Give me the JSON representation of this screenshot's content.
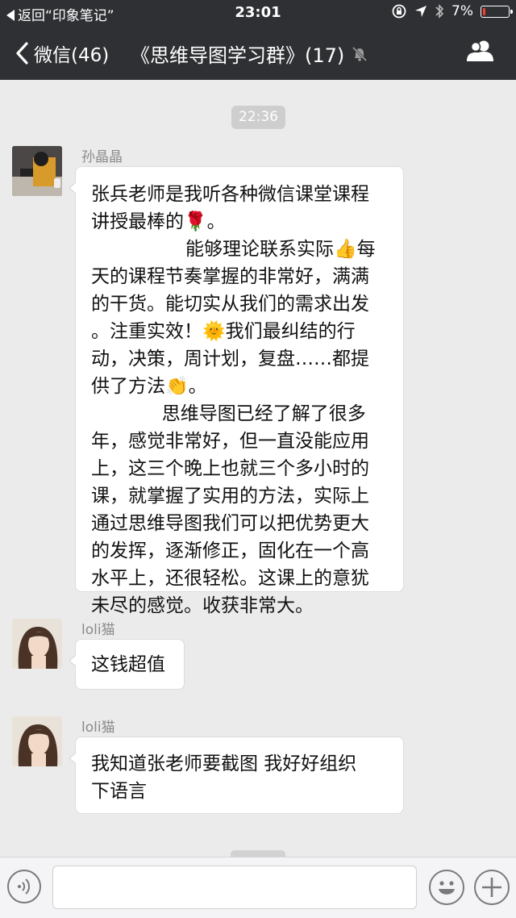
{
  "status_bar": {
    "back_app": "返回“印象笔记”",
    "time": "23:01",
    "battery": "7%",
    "battery_color": "#ff3b30"
  },
  "nav": {
    "back_label": "微信(46)",
    "title": "《思维导图学习群》(17)",
    "icons": [
      "chevron-left-icon",
      "mute-icon",
      "members-icon"
    ]
  },
  "chat": {
    "timestamp": "22:36",
    "messages": [
      {
        "sender": "孙晶晶",
        "lines": [
          "张兵老师是我听各种微信课堂课程",
          "讲授最棒的🌹。",
          "                能够理论联系实际👍每",
          "天的课程节奏掌握的非常好，满满",
          "的干货。能切实从我们的需求出发",
          "。注重实效！🌞我们最纠结的行",
          "动，决策，周计划，复盘……都提",
          "供了方法👏。",
          "            思维导图已经了解了很多",
          "年，感觉非常好，但一直没能应用",
          "上，这三个晚上也就三个多小时的",
          "课，就掌握了实用的方法，实际上",
          "通过思维导图我们可以把优势更大",
          "的发挥，逐渐修正，固化在一个高",
          "水平上，还很轻松。这课上的意犹",
          "未尽的感觉。收获非常大。"
        ]
      },
      {
        "sender": "loli猫",
        "lines": [
          "这钱超值"
        ]
      },
      {
        "sender": "loli猫",
        "lines": [
          "我知道张老师要截图 我好好组织",
          "下语言"
        ]
      }
    ]
  },
  "input_bar": {
    "placeholder": "",
    "icons": [
      "voice-icon",
      "emoji-icon",
      "plus-icon"
    ]
  },
  "colors": {
    "header_bg": "#2e3033",
    "chat_bg": "#ebebeb",
    "bubble_bg": "#ffffff"
  }
}
